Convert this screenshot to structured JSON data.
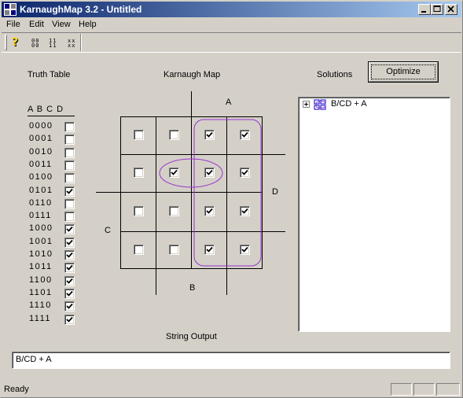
{
  "window": {
    "title": "KarnaughMap 3.2 - Untitled"
  },
  "menu": [
    "File",
    "Edit",
    "View",
    "Help"
  ],
  "toolbar": {
    "buttons": [
      {
        "icon": "help-icon"
      },
      {
        "icon": "grid-icon",
        "glyph": "00\n00"
      },
      {
        "icon": "ones-icon",
        "glyph": "11\n11"
      },
      {
        "icon": "dont-care-icon",
        "glyph": "xx\nxx"
      }
    ]
  },
  "truth_table": {
    "title": "Truth Table",
    "header": "A B C D",
    "rows": [
      {
        "label": "0000",
        "checked": false
      },
      {
        "label": "0001",
        "checked": false
      },
      {
        "label": "0010",
        "checked": false
      },
      {
        "label": "0011",
        "checked": false
      },
      {
        "label": "0100",
        "checked": false
      },
      {
        "label": "0101",
        "checked": true
      },
      {
        "label": "0110",
        "checked": false
      },
      {
        "label": "0111",
        "checked": false
      },
      {
        "label": "1000",
        "checked": true
      },
      {
        "label": "1001",
        "checked": true
      },
      {
        "label": "1010",
        "checked": true
      },
      {
        "label": "1011",
        "checked": true
      },
      {
        "label": "1100",
        "checked": true
      },
      {
        "label": "1101",
        "checked": true
      },
      {
        "label": "1110",
        "checked": true
      },
      {
        "label": "1111",
        "checked": true
      }
    ]
  },
  "karnaugh_map": {
    "title": "Karnaugh Map",
    "label_a": "A",
    "label_b": "B",
    "label_c": "C",
    "label_d": "D",
    "cells": [
      [
        false,
        false,
        true,
        true
      ],
      [
        false,
        true,
        true,
        true
      ],
      [
        false,
        false,
        true,
        true
      ],
      [
        false,
        false,
        true,
        true
      ]
    ],
    "group_color": "#9933cc"
  },
  "solutions": {
    "title": "Solutions",
    "optimize_label": "Optimize",
    "items": [
      {
        "label": "B/CD + A"
      }
    ]
  },
  "string_output": {
    "title": "String Output",
    "value": "B/CD + A"
  },
  "status": {
    "text": "Ready"
  }
}
